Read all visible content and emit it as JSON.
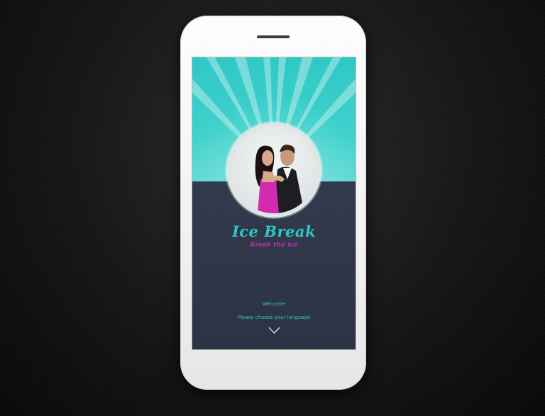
{
  "app": {
    "title": "Ice Break",
    "tagline": "Break the ice"
  },
  "welcome": {
    "greeting": "Welcome",
    "prompt": "Please choose your language"
  },
  "icons": {
    "language_dropdown": "chevron-down-icon"
  },
  "colors": {
    "accent_teal": "#2ec7c3",
    "accent_magenta": "#b530a3",
    "panel_navy": "#2d3446",
    "header_teal": "#3fd1cc"
  }
}
